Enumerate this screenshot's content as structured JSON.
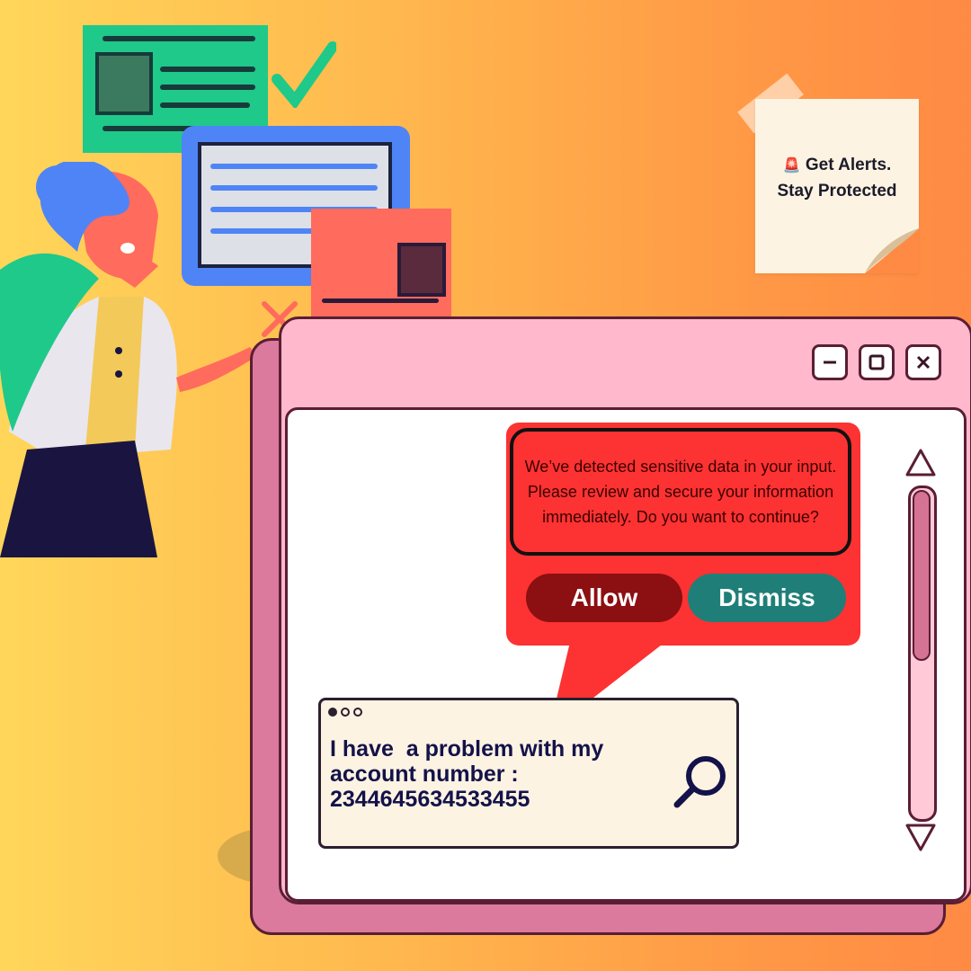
{
  "sticky_note": {
    "alarm_icon": "🚨",
    "line1": "Get Alerts.",
    "line2": "Stay Protected"
  },
  "window": {
    "controls": [
      "minimize-icon",
      "maximize-icon",
      "close-icon"
    ],
    "colors": {
      "title_bar": "#ffb8cc",
      "frame": "#5a1e34",
      "shadow": "#db7a9c"
    }
  },
  "alert": {
    "message": "We’ve detected sensitive data in your input. Please review and secure your information immediately. Do you want to continue?",
    "allow_label": "Allow",
    "dismiss_label": "Dismiss",
    "colors": {
      "background": "#fd3232",
      "allow": "#8c0f12",
      "dismiss": "#1f7f78"
    }
  },
  "input": {
    "line1": "I have  a problem with my",
    "line2": "account number :",
    "line3": "2344645634533455"
  }
}
